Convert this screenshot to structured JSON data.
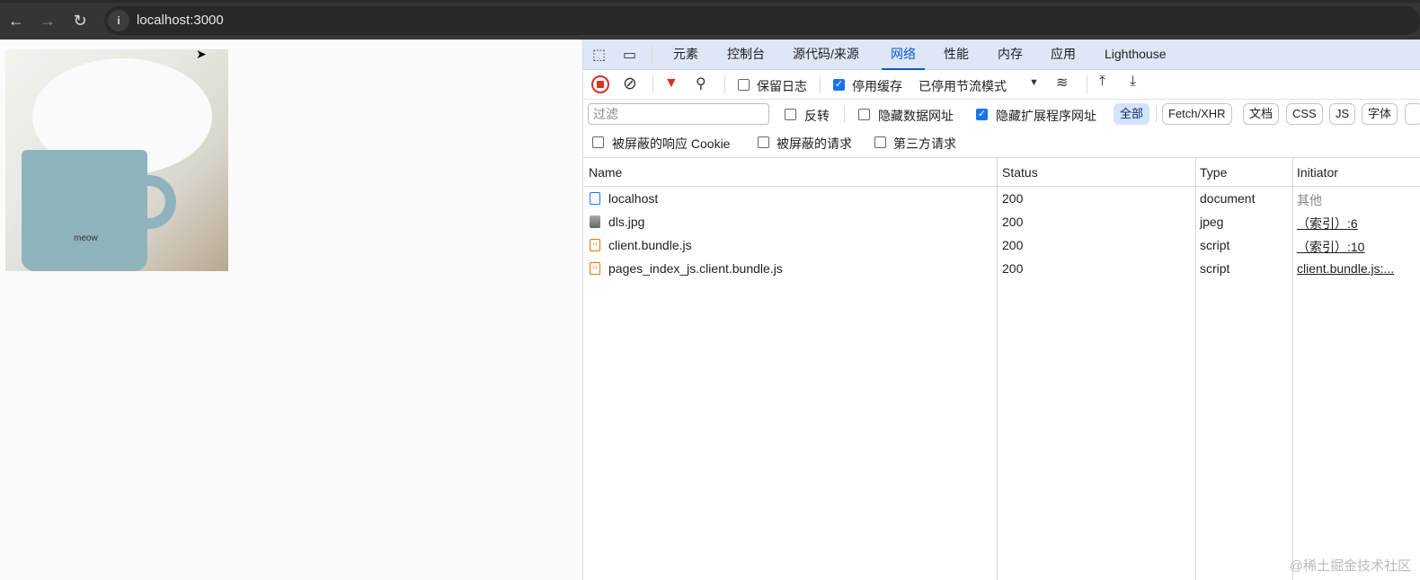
{
  "browser": {
    "url": "localhost:3000",
    "back_icon": "arrow-left",
    "forward_icon": "arrow-right",
    "reload_icon": "reload",
    "info_icon": "info"
  },
  "page": {
    "image_text": "meow"
  },
  "devtools": {
    "tabs": [
      {
        "label": "元素"
      },
      {
        "label": "控制台"
      },
      {
        "label": "源代码/来源"
      },
      {
        "label": "网络",
        "active": true
      },
      {
        "label": "性能"
      },
      {
        "label": "内存"
      },
      {
        "label": "应用"
      },
      {
        "label": "Lighthouse"
      }
    ],
    "toolbar": {
      "preserve_log": "保留日志",
      "preserve_log_checked": false,
      "disable_cache": "停用缓存",
      "disable_cache_checked": true,
      "throttling": "已停用节流模式"
    },
    "filter": {
      "placeholder": "过滤",
      "invert": "反转",
      "hide_data_urls": "隐藏数据网址",
      "hide_ext_urls": "隐藏扩展程序网址",
      "hide_ext_checked": true,
      "types": [
        "全部",
        "Fetch/XHR",
        "文档",
        "CSS",
        "JS",
        "字体"
      ],
      "selected_type": "全部"
    },
    "options": {
      "blocked_cookies": "被屏蔽的响应 Cookie",
      "blocked_requests": "被屏蔽的请求",
      "third_party": "第三方请求"
    },
    "table": {
      "headers": {
        "name": "Name",
        "status": "Status",
        "type": "Type",
        "initiator": "Initiator"
      },
      "rows": [
        {
          "name": "localhost",
          "status": "200",
          "type": "document",
          "initiator": "其他",
          "icon": "document"
        },
        {
          "name": "dls.jpg",
          "status": "200",
          "type": "jpeg",
          "initiator": "（索引）:6",
          "icon": "image"
        },
        {
          "name": "client.bundle.js",
          "status": "200",
          "type": "script",
          "initiator": "（索引）:10",
          "icon": "script"
        },
        {
          "name": "pages_index_js.client.bundle.js",
          "status": "200",
          "type": "script",
          "initiator": "client.bundle.js:...",
          "icon": "script"
        }
      ]
    }
  },
  "watermark": "@稀土掘金技术社区",
  "colors": {
    "accent": "#0b57d0",
    "record": "#d93025",
    "filter_icon": "#d93025"
  }
}
